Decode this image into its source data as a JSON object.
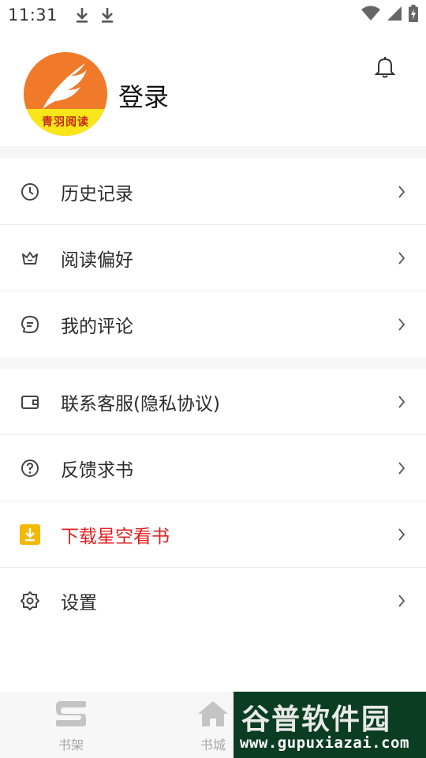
{
  "status_bar": {
    "time": "11:31",
    "icons": [
      "download-icon",
      "download-icon",
      "wifi-icon",
      "signal-icon",
      "battery-icon"
    ]
  },
  "profile": {
    "avatar_text": "青羽阅读",
    "login_label": "登录",
    "bell_icon": "bell-icon"
  },
  "menu_group_1": [
    {
      "label": "历史记录",
      "icon": "clock-icon"
    },
    {
      "label": "阅读偏好",
      "icon": "crown-icon"
    },
    {
      "label": "我的评论",
      "icon": "comment-icon"
    }
  ],
  "menu_group_2": [
    {
      "label": "联系客服(隐私协议)",
      "icon": "wallet-icon"
    },
    {
      "label": "反馈求书",
      "icon": "question-icon"
    },
    {
      "label": "下载星空看书",
      "icon": "download-box-icon"
    },
    {
      "label": "设置",
      "icon": "gear-icon"
    }
  ],
  "bottom_nav": [
    {
      "label": "书架",
      "icon": "bookshelf-icon"
    },
    {
      "label": "书城",
      "icon": "home-icon"
    }
  ],
  "watermark": {
    "title": "谷普软件园",
    "url": "www.gupuxiazai.com"
  },
  "colors": {
    "accent_red": "#e02020",
    "avatar_orange": "#f07a2a",
    "avatar_yellow": "#f8e61a",
    "download_badge": "#f5b800",
    "watermark_green": "#0b3d22"
  }
}
